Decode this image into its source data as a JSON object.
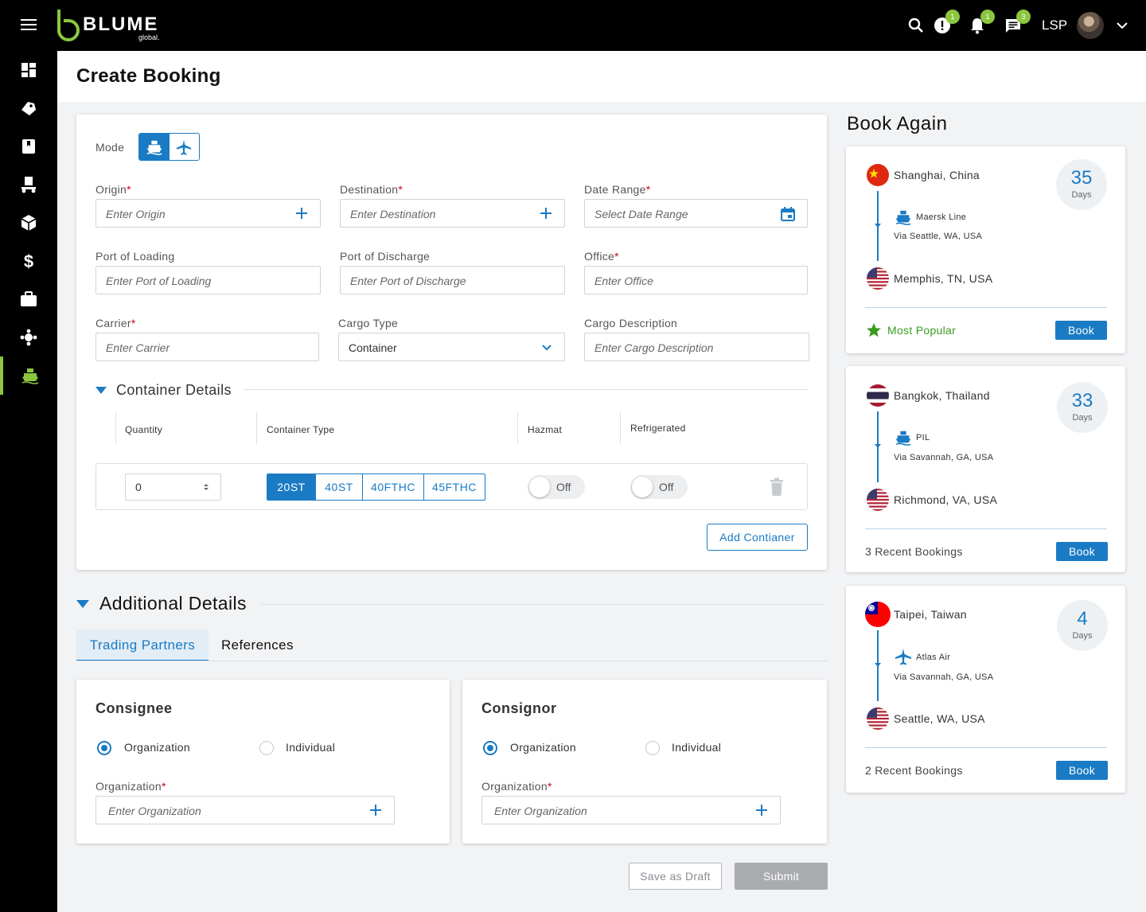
{
  "app": {
    "logo_text": "BLUME",
    "logo_sub": "global.",
    "user_role": "LSP",
    "badges": {
      "alerts": "1",
      "notifications": "1",
      "messages": "3"
    }
  },
  "page": {
    "title": "Create Booking"
  },
  "form": {
    "mode_label": "Mode",
    "origin": {
      "label": "Origin",
      "placeholder": "Enter Origin"
    },
    "destination": {
      "label": "Destination",
      "placeholder": "Enter Destination"
    },
    "date_range": {
      "label": "Date Range",
      "placeholder": "Select Date Range"
    },
    "port_loading": {
      "label": "Port of Loading",
      "placeholder": "Enter Port of Loading"
    },
    "port_discharge": {
      "label": "Port of Discharge",
      "placeholder": "Enter Port of Discharge"
    },
    "office": {
      "label": "Office",
      "placeholder": "Enter Office"
    },
    "carrier": {
      "label": "Carrier",
      "placeholder": "Enter Carrier"
    },
    "cargo_type": {
      "label": "Cargo Type",
      "value": "Container"
    },
    "cargo_desc": {
      "label": "Cargo Description",
      "placeholder": "Enter Cargo Description"
    },
    "required_mark": "*"
  },
  "container": {
    "title": "Container Details",
    "columns": {
      "quantity": "Quantity",
      "type": "Container Type",
      "hazmat": "Hazmat",
      "refrigerated": "Refrigerated"
    },
    "quantity_value": "0",
    "types": [
      "20ST",
      "40ST",
      "40FTHC",
      "45FTHC"
    ],
    "selected_type": "20ST",
    "hazmat_state": "Off",
    "refrigerated_state": "Off",
    "add_button": "Add Contianer"
  },
  "additional": {
    "title": "Additional Details",
    "tabs": [
      "Trading Partners",
      "References"
    ],
    "consignee": {
      "title": "Consignee",
      "opt_org": "Organization",
      "opt_ind": "Individual",
      "org_label": "Organization",
      "org_placeholder": "Enter Organization"
    },
    "consignor": {
      "title": "Consignor",
      "opt_org": "Organization",
      "opt_ind": "Individual",
      "org_label": "Organization",
      "org_placeholder": "Enter Organization"
    }
  },
  "actions": {
    "draft": "Save as Draft",
    "submit": "Submit"
  },
  "book_again": {
    "title": "Book Again",
    "cards": [
      {
        "origin": "Shanghai, China",
        "carrier": "Maersk Line",
        "via": "Via Seattle, WA, USA",
        "destination": "Memphis, TN, USA",
        "days": "35",
        "days_label": "Days",
        "footer": "Most Popular",
        "book": "Book",
        "mode_icon": "ship-icon"
      },
      {
        "origin": "Bangkok, Thailand",
        "carrier": "PIL",
        "via": "Via Savannah, GA, USA",
        "destination": "Richmond, VA, USA",
        "days": "33",
        "days_label": "Days",
        "footer": "3 Recent Bookings",
        "book": "Book",
        "mode_icon": "ship-icon"
      },
      {
        "origin": "Taipei, Taiwan",
        "carrier": "Atlas Air",
        "via": "Via Savannah, GA, USA",
        "destination": "Seattle, WA, USA",
        "days": "4",
        "days_label": "Days",
        "footer": "2 Recent Bookings",
        "book": "Book",
        "mode_icon": "plane-icon"
      }
    ]
  },
  "colors": {
    "accent": "#1a7bc4",
    "brand_green": "#8cc63f",
    "required": "#d0021b",
    "popular": "#3a9b1f"
  }
}
